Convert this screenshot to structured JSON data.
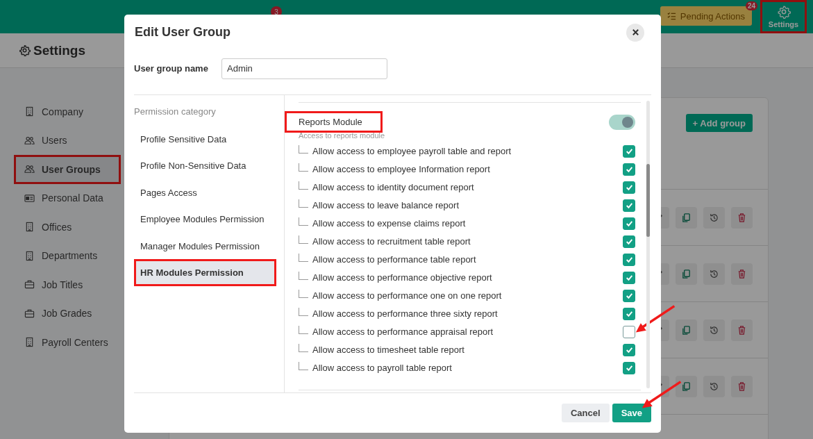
{
  "header": {
    "feed_badge": "3",
    "pending_actions": {
      "label": "Pending Actions",
      "badge": "24"
    },
    "settings_button": {
      "label": "Settings",
      "annotated": true
    }
  },
  "page_title": "Settings",
  "sidebar": {
    "items": [
      {
        "label": "Company",
        "kind": "building",
        "selected": false,
        "annotated": false
      },
      {
        "label": "Users",
        "kind": "users",
        "selected": false,
        "annotated": false
      },
      {
        "label": "User Groups",
        "kind": "users",
        "selected": true,
        "annotated": true
      },
      {
        "label": "Personal Data",
        "kind": "card",
        "selected": false,
        "annotated": false
      },
      {
        "label": "Offices",
        "kind": "building",
        "selected": false,
        "annotated": false
      },
      {
        "label": "Departments",
        "kind": "building",
        "selected": false,
        "annotated": false
      },
      {
        "label": "Job Titles",
        "kind": "briefcase",
        "selected": false,
        "annotated": false
      },
      {
        "label": "Job Grades",
        "kind": "briefcase",
        "selected": false,
        "annotated": false
      },
      {
        "label": "Payroll Centers",
        "kind": "building",
        "selected": false,
        "annotated": false
      }
    ]
  },
  "groups_panel": {
    "add_button": "+ Add group"
  },
  "dialog": {
    "title": "Edit User Group",
    "name_label": "User group name",
    "name_value": "Admin",
    "category_heading": "Permission category",
    "categories": [
      {
        "label": "Profile Sensitive Data",
        "selected": false,
        "annotated": false
      },
      {
        "label": "Profile Non-Sensitive Data",
        "selected": false,
        "annotated": false
      },
      {
        "label": "Pages Access",
        "selected": false,
        "annotated": false
      },
      {
        "label": "Employee Modules Permission",
        "selected": false,
        "annotated": false
      },
      {
        "label": "Manager Modules Permission",
        "selected": false,
        "annotated": false
      },
      {
        "label": "HR Modules Permission",
        "selected": true,
        "annotated": true
      }
    ],
    "module": {
      "title": "Reports Module",
      "annotated": true,
      "enabled": true,
      "description": "Access to reports module",
      "permissions": [
        {
          "label": "Allow access to employee payroll table and report",
          "checked": true,
          "arrow": false
        },
        {
          "label": "Allow access to employee Information report",
          "checked": true,
          "arrow": false
        },
        {
          "label": "Allow access to identity document report",
          "checked": true,
          "arrow": false
        },
        {
          "label": "Allow access to leave balance report",
          "checked": true,
          "arrow": false
        },
        {
          "label": "Allow access to expense claims report",
          "checked": true,
          "arrow": false
        },
        {
          "label": "Allow access to recruitment table report",
          "checked": true,
          "arrow": false
        },
        {
          "label": "Allow access to performance table report",
          "checked": true,
          "arrow": false
        },
        {
          "label": "Allow access to performance objective report",
          "checked": true,
          "arrow": false
        },
        {
          "label": "Allow access to performance one on one report",
          "checked": true,
          "arrow": false
        },
        {
          "label": "Allow access to performance three sixty report",
          "checked": true,
          "arrow": false
        },
        {
          "label": "Allow access to performance appraisal report",
          "checked": false,
          "arrow": true
        },
        {
          "label": "Allow access to timesheet table report",
          "checked": true,
          "arrow": false
        },
        {
          "label": "Allow access to payroll table report",
          "checked": true,
          "arrow": false
        }
      ]
    },
    "cancel": "Cancel",
    "save": "Save",
    "save_arrow": true
  }
}
